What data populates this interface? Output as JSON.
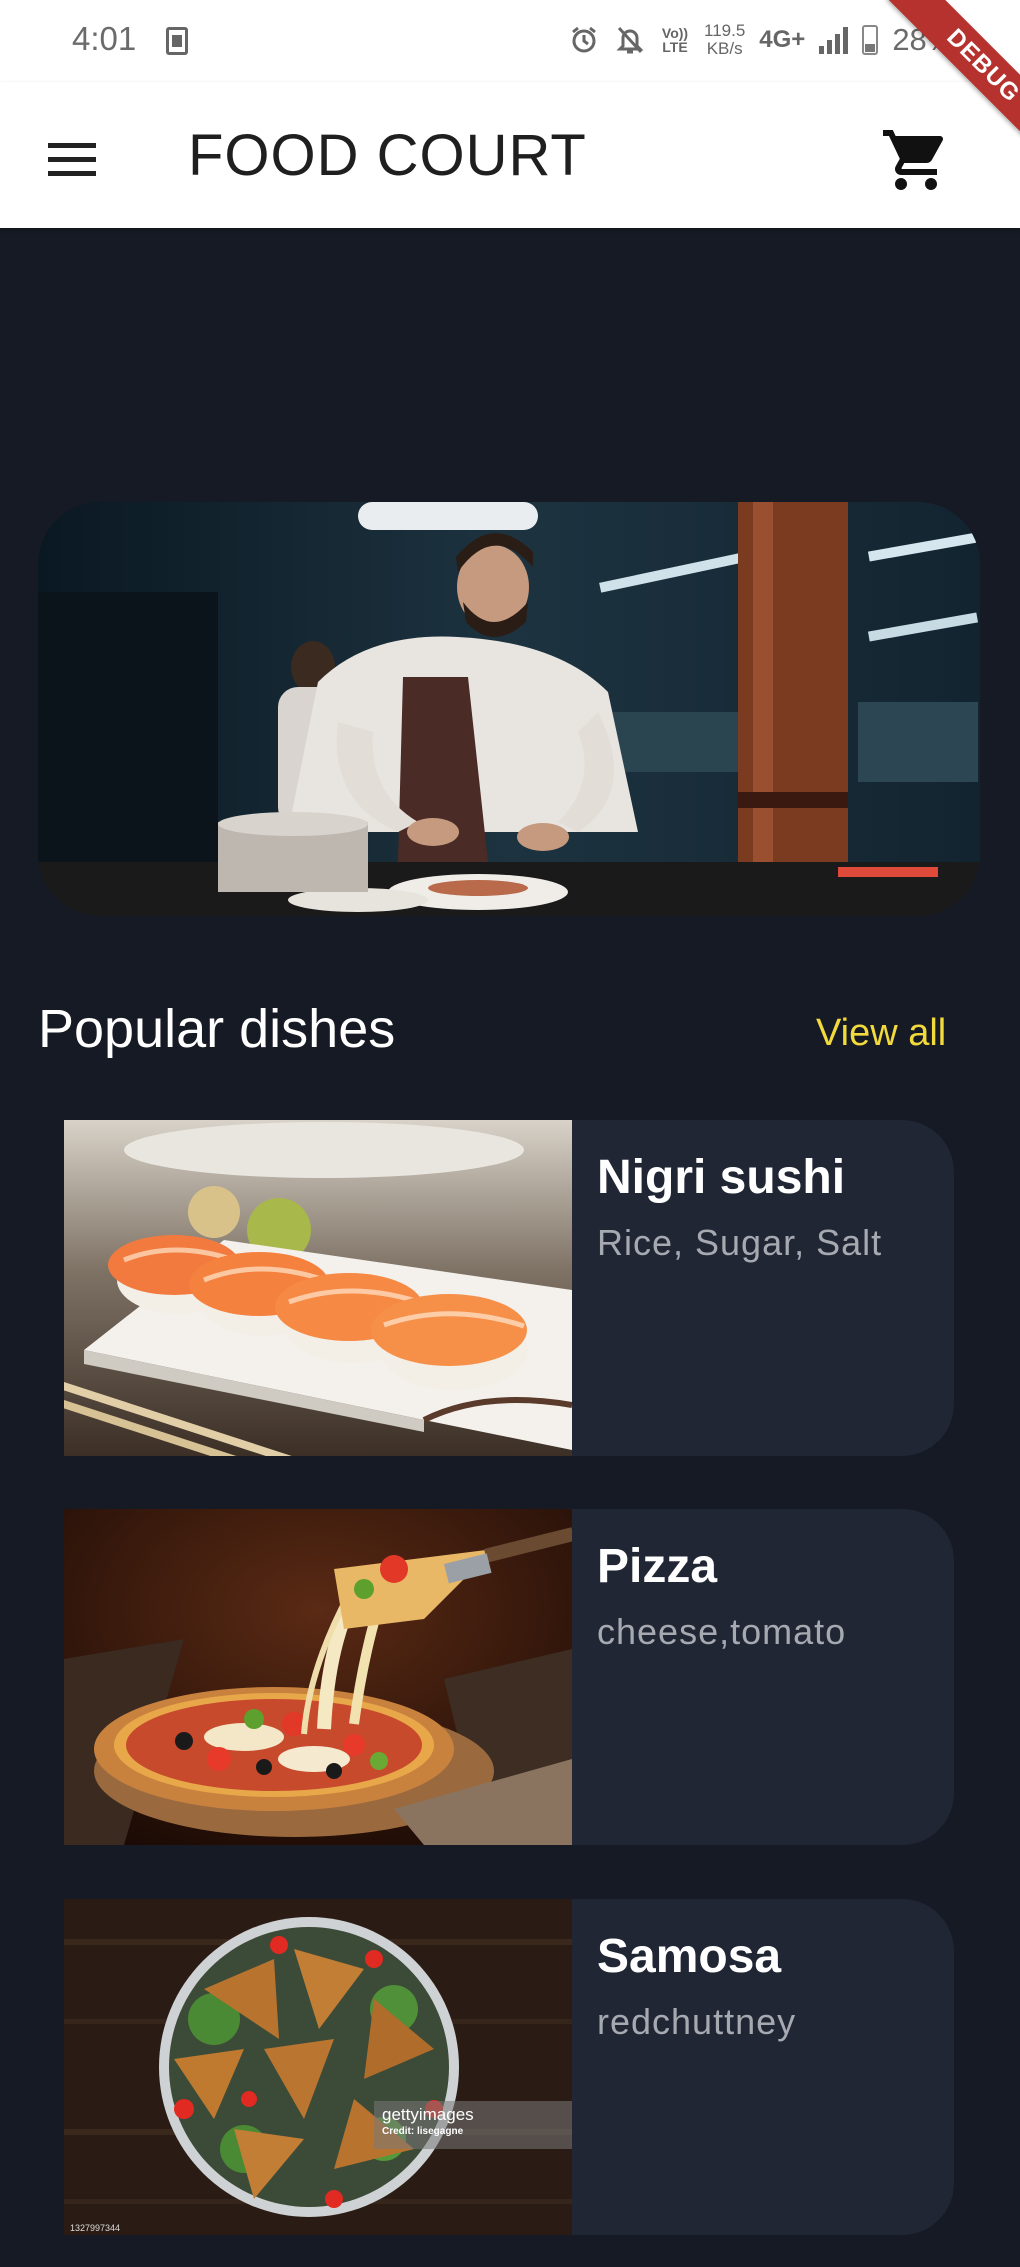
{
  "status_bar": {
    "time": "4:01",
    "volte": "Vo)) LTE",
    "speed_value": "119.5",
    "speed_unit": "KB/s",
    "network": "4G+",
    "battery": "28%"
  },
  "debug_banner": "DEBUG",
  "app_bar": {
    "title": "FOOD COURT"
  },
  "section": {
    "title": "Popular dishes",
    "view_all": "View all"
  },
  "dishes": [
    {
      "name": "Nigri sushi",
      "ingredients": "Rice, Sugar, Salt"
    },
    {
      "name": "Pizza",
      "ingredients": "cheese,tomato"
    },
    {
      "name": "Samosa",
      "ingredients": "redchuttney",
      "watermark_brand": "gettyimages",
      "watermark_credit": "Credit: lisegagne",
      "image_id": "1327997344"
    }
  ],
  "colors": {
    "background": "#161a24",
    "card": "#212635",
    "accent": "#f2da3c",
    "debug": "#b5322e"
  },
  "icons": {
    "menu": "menu-icon",
    "cart": "shopping-cart-icon"
  }
}
